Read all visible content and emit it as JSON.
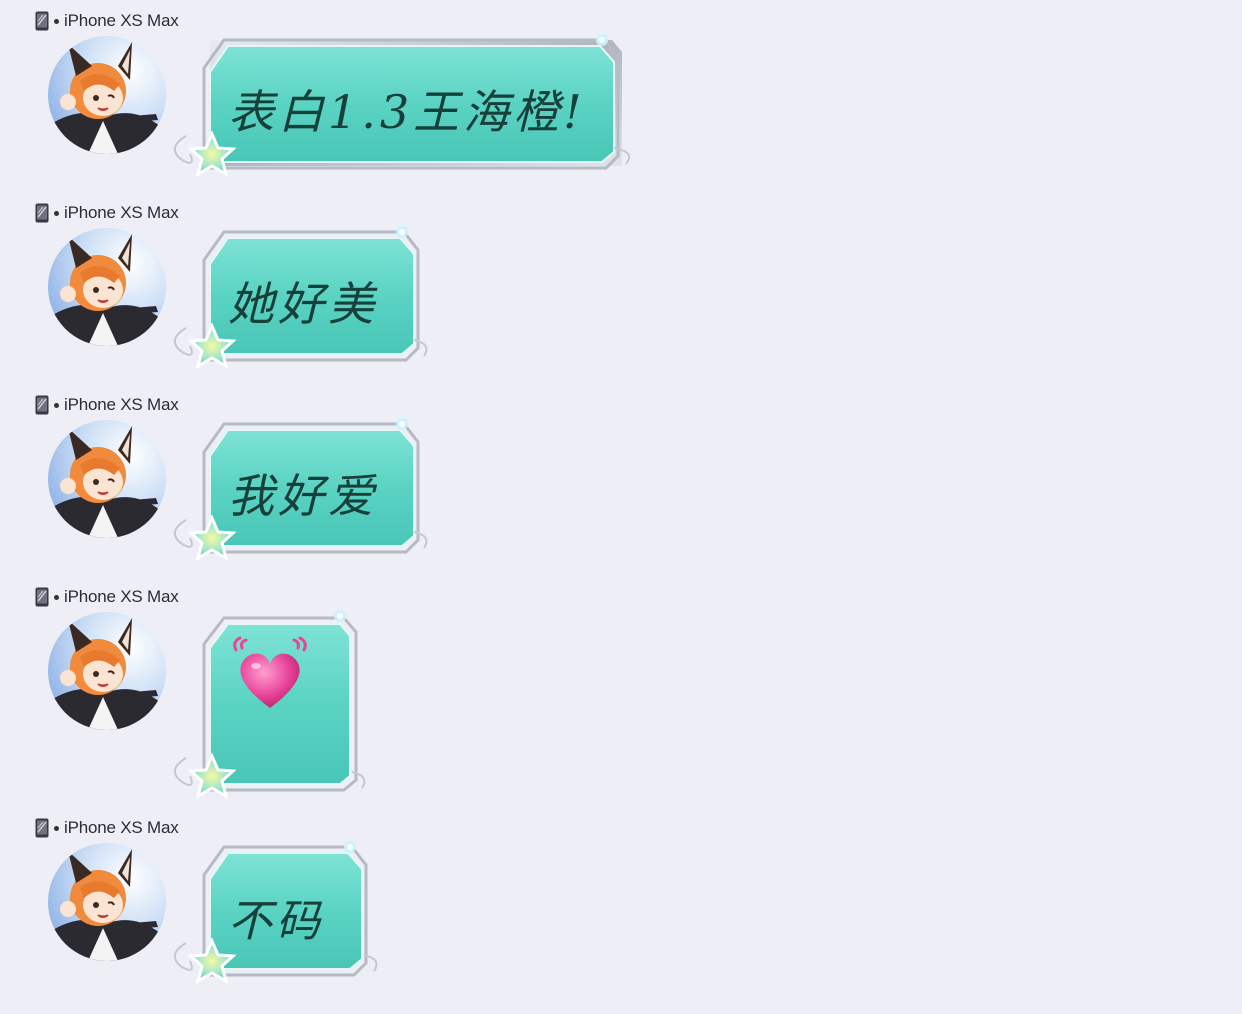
{
  "messages": [
    {
      "sender": "iPhone XS Max",
      "device_icon": "phone-icon",
      "avatar": "fox-girl-avatar",
      "text": "表白1.3王海橙!"
    },
    {
      "sender": "iPhone XS Max",
      "device_icon": "phone-icon",
      "avatar": "fox-girl-avatar",
      "text": "她好美"
    },
    {
      "sender": "iPhone XS Max",
      "device_icon": "phone-icon",
      "avatar": "fox-girl-avatar",
      "text": "我好爱"
    },
    {
      "sender": "iPhone XS Max",
      "device_icon": "phone-icon",
      "avatar": "fox-girl-avatar",
      "emoji": "beating-heart-icon"
    },
    {
      "sender": "iPhone XS Max",
      "device_icon": "phone-icon",
      "avatar": "fox-girl-avatar",
      "text": "不码"
    }
  ],
  "colors": {
    "background": "#eeeef6",
    "bubble_fill": "#5fd6c6",
    "bubble_border": "#c8ccd4",
    "text": "#17403a",
    "heart": "#e8449a"
  }
}
